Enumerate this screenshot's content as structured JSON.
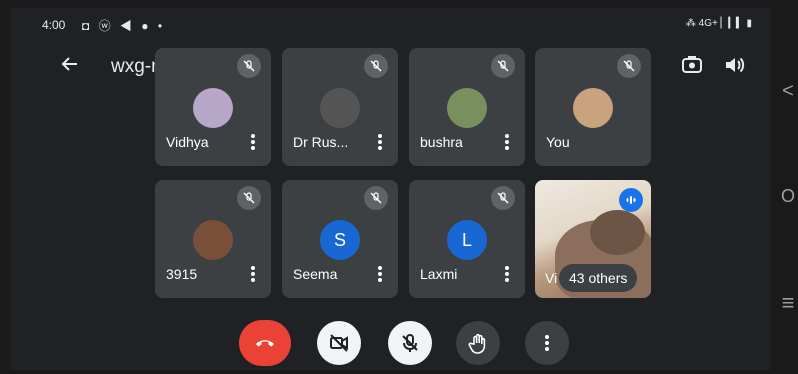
{
  "status_bar": {
    "time": "4:00",
    "icons": "◘ ⓦ ◀ ● •",
    "right": "⁂ 4G+ ▏▎▍ ▮"
  },
  "header": {
    "meeting_code": "wxg-njqs-osb ▸",
    "icons": [
      "back-arrow-icon",
      "switch-camera-icon",
      "speaker-icon"
    ]
  },
  "participants": [
    {
      "name": "Vidhya",
      "avatar_color": "#b7a7c9",
      "muted": true
    },
    {
      "name": "Dr Rus...",
      "avatar_color": "#555555",
      "muted": true
    },
    {
      "name": "bushra",
      "avatar_color": "#7a8f5e",
      "muted": true
    },
    {
      "name": "You",
      "avatar_color": "#c9a27e",
      "muted": true
    },
    {
      "name": "3915",
      "avatar_color": "#7a4f3a",
      "muted": true
    },
    {
      "name": "Seema",
      "avatar_initial": "S",
      "avatar_color": "#1967d2",
      "muted": true
    },
    {
      "name": "Laxmi",
      "avatar_initial": "L",
      "avatar_color": "#1967d2",
      "muted": true
    }
  ],
  "video_tile": {
    "name": "Vi",
    "others_label": "43 others"
  },
  "controls": {
    "end_call_color": "#ea4335",
    "items": [
      "end-call-icon",
      "camera-off-icon",
      "mic-off-icon",
      "raise-hand-icon",
      "more-options-icon"
    ]
  },
  "nav": {
    "back": "<",
    "home": "O",
    "recents": "≡"
  }
}
